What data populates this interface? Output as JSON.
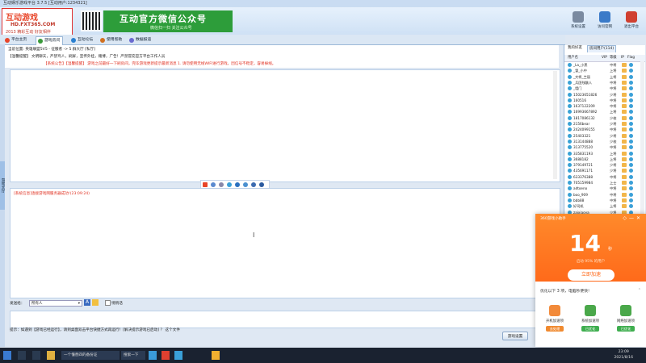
{
  "window": {
    "title": "互动娱乐游戏平台 3.7.5 [互动用户:1234321]"
  },
  "header": {
    "logo": {
      "line1": "互动游戏",
      "line2": "HD.FXT365.COM",
      "line3": "2013 精彩互动 好友相伴"
    },
    "banner": {
      "title": "互动官方微信公众号",
      "subtitle": "微信扫一扫  关注公众号"
    },
    "buttons": [
      {
        "label": "系统设置",
        "color": "#7a8aa0"
      },
      {
        "label": "访问官网",
        "color": "#3a7ac8"
      },
      {
        "label": "退出平台",
        "color": "#d04030"
      }
    ]
  },
  "tabs": [
    {
      "label": "平台主页",
      "color": "#e8462a"
    },
    {
      "label": "游戏房间",
      "color": "#3a9a3a"
    },
    {
      "label": "互动论坛",
      "color": "#2a80d0"
    },
    {
      "label": "使用帮助",
      "color": "#d07020"
    },
    {
      "label": "数据报道",
      "color": "#6a6ad0"
    }
  ],
  "room": {
    "location": "当前位置: 英雄联盟5V5 - 征服者 -> 5 群大厅 [私厅]",
    "rules": "【温馨提醒】 文明聊天，严禁骂人，刷屏，宣传外挂，赌博，广告！严禁冒充官方平台工作人员",
    "notice": "【系统公告】【温馨提醒】 游戏之前最好一下刷房间，完毕游戏更新提示最新消息       1. 请勿使用无线WIFI进行游戏，因信号不稳定，容易掉线。",
    "status_message": "[系统信息]连接游戏网服务器成功!(23:09:24)"
  },
  "toolbar_icons": [
    "emoji-icon",
    "chinese-icon",
    "dot-icon",
    "smile-icon",
    "mic-icon",
    "user-icon",
    "shirt-icon",
    "gift-icon"
  ],
  "input": {
    "sendto_label": "发送给：",
    "sendto_value": "所有人",
    "private_label": "悄悄话",
    "hint": "提示：如遇到【游戏已经运行】，请到桌面双击平台快捷方式再运行！[解决提示游戏已启动]  ？ 这个文件",
    "game_settings_button": "游戏设置"
  },
  "userpanel": {
    "tabs": [
      "我的好友",
      "房间用户(114)"
    ],
    "headers": [
      "用户名",
      "VIP",
      "等级",
      "IP",
      "Flag"
    ],
    "users": [
      {
        "name": "_La_小黑",
        "level": "中将"
      },
      {
        "name": "_冒_小中",
        "level": "上将"
      },
      {
        "name": "_大将_兰丽",
        "level": "上将"
      },
      {
        "name": "_兵团残骸人",
        "level": "中将"
      },
      {
        "name": "_墙门",
        "level": "中将"
      },
      {
        "name": "15023651826",
        "level": "少将"
      },
      {
        "name": "160516",
        "level": "中将"
      },
      {
        "name": "1637122209",
        "level": "中将"
      },
      {
        "name": "16993667892",
        "level": "上将"
      },
      {
        "name": "1817086132",
        "level": "少校"
      },
      {
        "name": "2156bear",
        "level": "少将"
      },
      {
        "name": "2424099155",
        "level": "中将"
      },
      {
        "name": "25403321",
        "level": "少将"
      },
      {
        "name": "313144888",
        "level": "少校"
      },
      {
        "name": "313775520",
        "level": "中将"
      },
      {
        "name": "335831193",
        "level": "上将"
      },
      {
        "name": "3688182",
        "level": "上将"
      },
      {
        "name": "379149721",
        "level": "少将"
      },
      {
        "name": "435691171",
        "level": "少将"
      },
      {
        "name": "633376388",
        "level": "中将"
      },
      {
        "name": "705159984",
        "level": "上士"
      },
      {
        "name": "adtoeno",
        "level": "中将"
      },
      {
        "name": "boo_909",
        "level": "中将"
      },
      {
        "name": "bbb88",
        "level": "中将"
      },
      {
        "name": "好司机",
        "level": "上将"
      },
      {
        "name": "zaixiaoya",
        "level": "少将"
      }
    ]
  },
  "popup": {
    "title": "360游戏小助手",
    "big_number": "14",
    "unit": "秒",
    "subtitle": "启动 95% 的用户",
    "button": "立即加速",
    "tip": "优化以下 3 项，电脑秒便快！",
    "items": [
      {
        "label": "开机加速项",
        "status": "去处理",
        "color": "#f28a3a",
        "status_color": "#f08a30"
      },
      {
        "label": "系统加速项",
        "status": "已优化",
        "color": "#4aa84a",
        "status_color": "#3fae4f"
      },
      {
        "label": "网络加速项",
        "status": "已优化",
        "color": "#4aa84a",
        "status_color": "#3fae4f"
      }
    ]
  },
  "taskbar": {
    "items": [
      "一个懂善四的备份证",
      "搜索一下"
    ],
    "time": "23:09",
    "date": "2021/8/16"
  }
}
